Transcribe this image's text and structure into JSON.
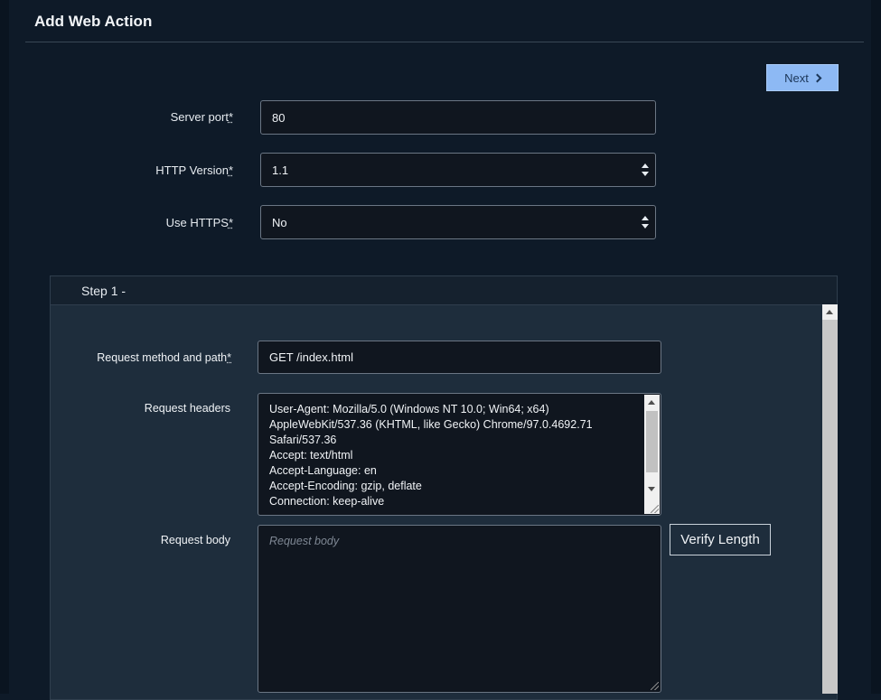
{
  "header": {
    "title": "Add Web Action"
  },
  "toolbar": {
    "next_label": "Next"
  },
  "form": {
    "server_port": {
      "label": "Server port",
      "required_mark": "*",
      "value": "80"
    },
    "http_version": {
      "label": "HTTP Version",
      "required_mark": "*",
      "value": "1.1"
    },
    "use_https": {
      "label": "Use HTTPS",
      "required_mark": "*",
      "value": "No"
    }
  },
  "step": {
    "title": "Step 1 -",
    "request_method": {
      "label": "Request method and path",
      "required_mark": "*",
      "value": "GET /index.html"
    },
    "request_headers": {
      "label": "Request headers",
      "lines": [
        "User-Agent: Mozilla/5.0 (Windows NT 10.0; Win64; x64)",
        "AppleWebKit/537.36 (KHTML, like Gecko) Chrome/97.0.4692.71",
        "Safari/537.36",
        "Accept: text/html",
        "Accept-Language: en",
        "Accept-Encoding: gzip, deflate",
        "Connection: keep-alive"
      ]
    },
    "request_body": {
      "label": "Request body",
      "placeholder": "Request body",
      "value": ""
    },
    "verify_label": "Verify Length"
  },
  "icons": {
    "next": "chevron-right-icon",
    "select": "select-arrows-icon"
  }
}
